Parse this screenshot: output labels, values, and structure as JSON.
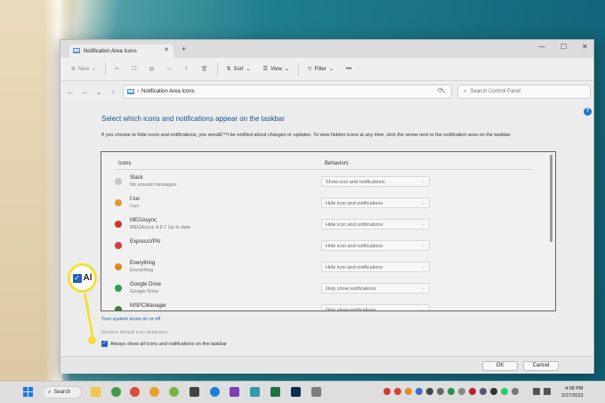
{
  "window": {
    "tab_title": "Notification Area Icons",
    "minimize": "—",
    "maximize": "☐",
    "close": "✕"
  },
  "toolbar": {
    "new_label": "New",
    "sort_label": "Sort",
    "view_label": "View",
    "filter_label": "Filter",
    "more_label": "•••"
  },
  "address": {
    "path": "Notification Area Icons",
    "search_placeholder": "Search Control Panel"
  },
  "main": {
    "heading": "Select which icons and notifications appear on the taskbar",
    "description": "If you choose to hide icons and notifications, you wonâ€™t be notified about changes or updates. To view hidden icons at any time, click the arrow next to the notification area on the taskbar.",
    "col_icons": "Icons",
    "col_behaviors": "Behaviors",
    "rows": [
      {
        "name": "Slack",
        "sub": "No unread messages",
        "behavior": "Show icon and notifications",
        "color": "#c9c9c9"
      },
      {
        "name": "f.lux",
        "sub": "f.lux",
        "behavior": "Hide icon and notifications",
        "color": "#e39a2b"
      },
      {
        "name": "MEGAsync",
        "sub": "MEGAsync 4.8.7 Up to date",
        "behavior": "Hide icon and notifications",
        "color": "#d9302c"
      },
      {
        "name": "ExpressVPN",
        "sub": "",
        "behavior": "Hide icon and notifications",
        "color": "#d33b3b"
      },
      {
        "name": "Everything",
        "sub": "Everything",
        "behavior": "Hide icon and notifications",
        "color": "#e08a1e"
      },
      {
        "name": "Google Drive",
        "sub": "Google Drive",
        "behavior": "Only show notifications",
        "color": "#2f9e57"
      },
      {
        "name": "MSPCManager",
        "sub": "",
        "behavior": "Only show notifications",
        "color": "#3f7f3a"
      }
    ],
    "link_system_icons": "Turn system icons on or off",
    "link_restore": "Restore default icon behaviors",
    "always_show_label": "Always show all icons and notifications on the taskbar"
  },
  "footer": {
    "ok_label": "OK",
    "cancel_label": "Cancel"
  },
  "callout": {
    "text": "Al",
    "check": "✓"
  },
  "taskbar": {
    "search_label": "Search",
    "time": "4:08 PM",
    "date": "2/27/2023"
  }
}
